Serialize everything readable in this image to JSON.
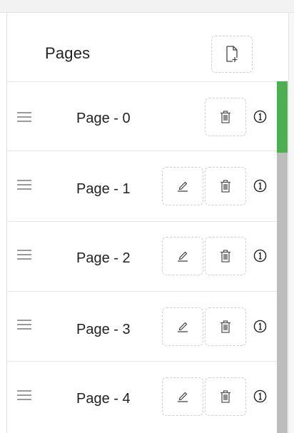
{
  "header": {
    "title": "Pages",
    "add_page_icon": "add-page-icon"
  },
  "pages": [
    {
      "label": "Page - 0",
      "editable": false
    },
    {
      "label": "Page - 1",
      "editable": true
    },
    {
      "label": "Page - 2",
      "editable": true
    },
    {
      "label": "Page - 3",
      "editable": true
    },
    {
      "label": "Page - 4",
      "editable": true
    }
  ],
  "icons": {
    "drag": "drag-handle-icon",
    "edit": "edit-pencil-icon",
    "delete": "trash-icon",
    "info": "info-icon"
  },
  "colors": {
    "scroll_thumb": "#4caf50",
    "scroll_track": "#bdbdbd",
    "dashed_border": "#cfcfcf"
  }
}
